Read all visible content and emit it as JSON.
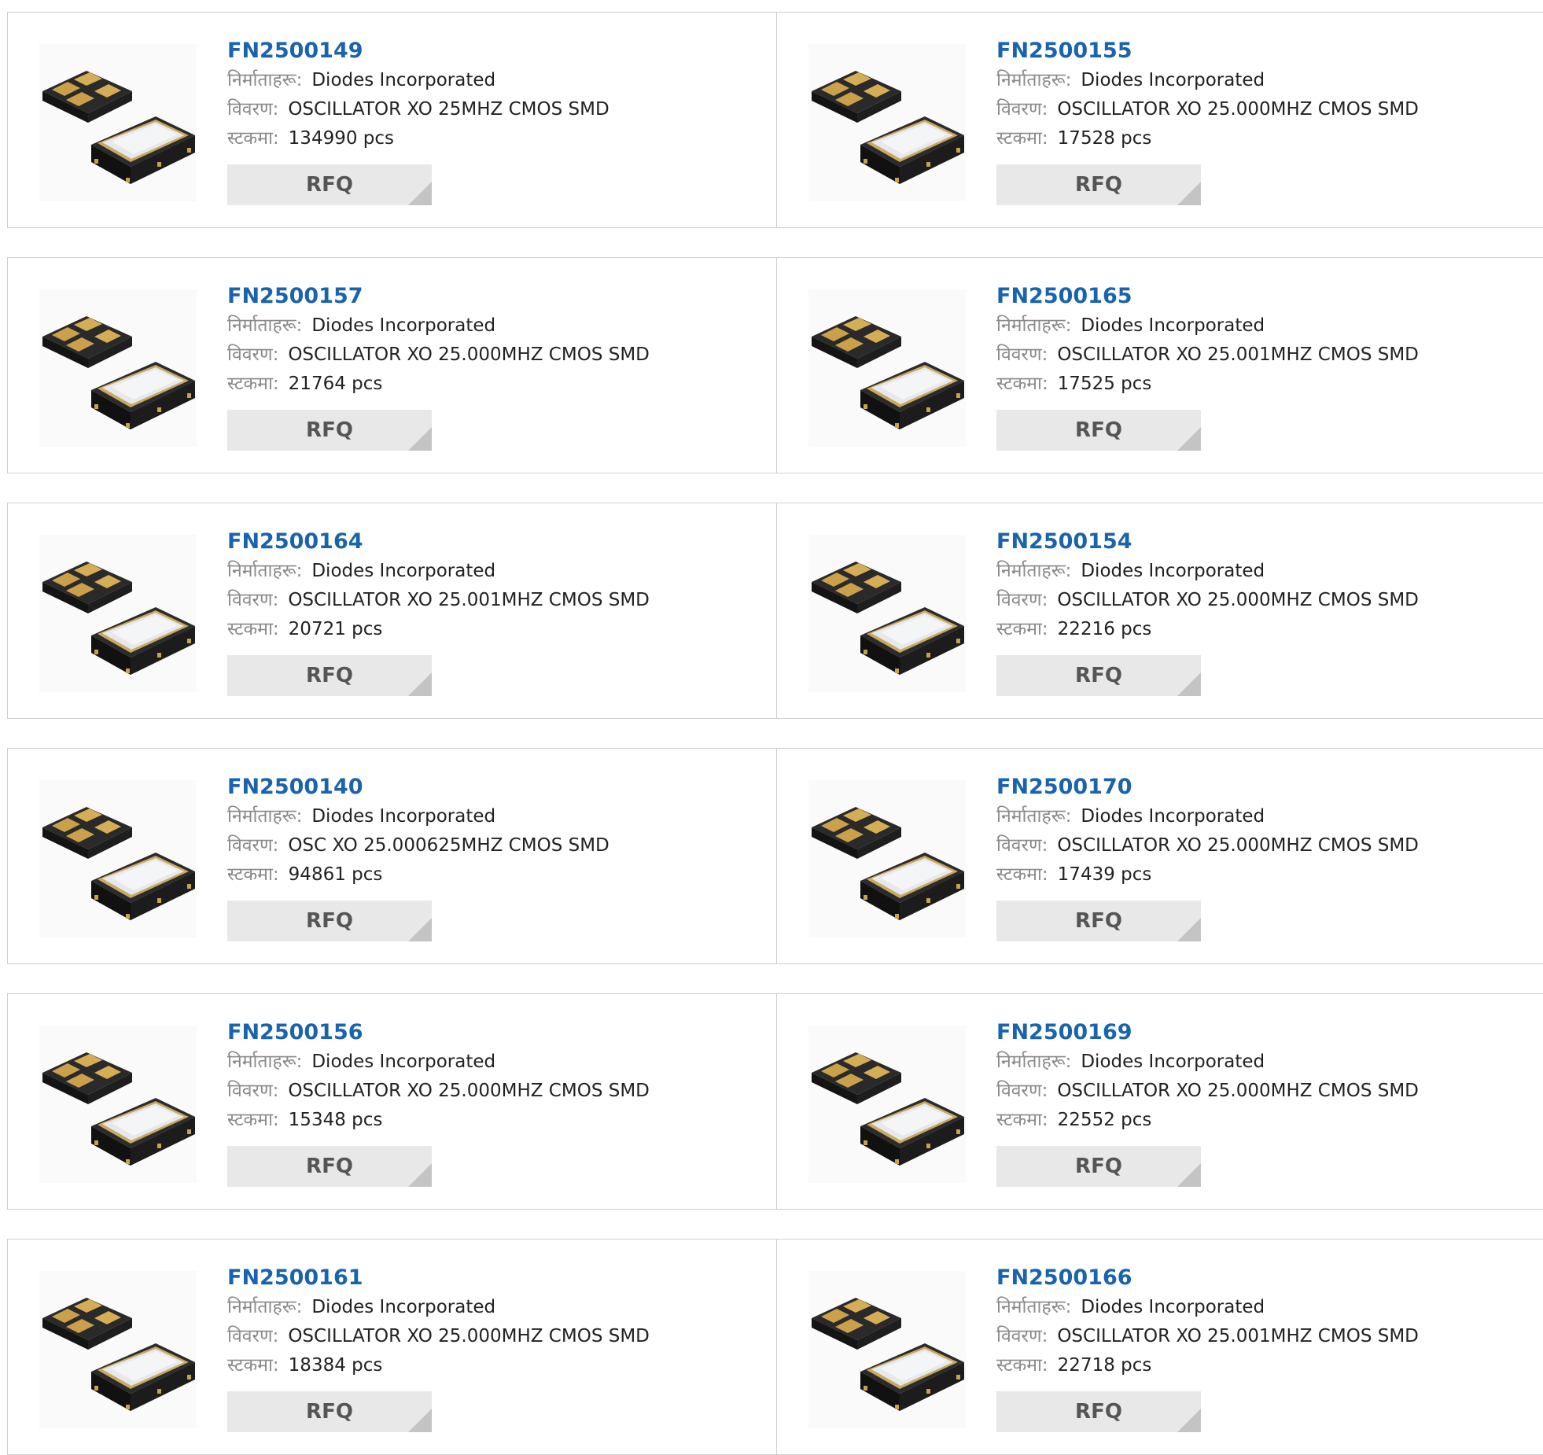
{
  "labels": {
    "manufacturer": "निर्माताहरू:",
    "description": "विवरण:",
    "stock": "स्टकमा:",
    "rfq": "RFQ"
  },
  "colors": {
    "link": "#1a64ad",
    "border": "#cfcfcf",
    "rfq_bg": "#e8e8e8",
    "rfq_corner": "#c4c4c4"
  },
  "products": [
    {
      "part": "FN2500149",
      "manufacturer": "Diodes Incorporated",
      "description": "OSCILLATOR XO 25MHZ CMOS SMD",
      "stock": "134990 pcs"
    },
    {
      "part": "FN2500155",
      "manufacturer": "Diodes Incorporated",
      "description": "OSCILLATOR XO 25.000MHZ CMOS SMD",
      "stock": "17528 pcs"
    },
    {
      "part": "FN2500157",
      "manufacturer": "Diodes Incorporated",
      "description": "OSCILLATOR XO 25.000MHZ CMOS SMD",
      "stock": "21764 pcs"
    },
    {
      "part": "FN2500165",
      "manufacturer": "Diodes Incorporated",
      "description": "OSCILLATOR XO 25.001MHZ CMOS SMD",
      "stock": "17525 pcs"
    },
    {
      "part": "FN2500164",
      "manufacturer": "Diodes Incorporated",
      "description": "OSCILLATOR XO 25.001MHZ CMOS SMD",
      "stock": "20721 pcs"
    },
    {
      "part": "FN2500154",
      "manufacturer": "Diodes Incorporated",
      "description": "OSCILLATOR XO 25.000MHZ CMOS SMD",
      "stock": "22216 pcs"
    },
    {
      "part": "FN2500140",
      "manufacturer": "Diodes Incorporated",
      "description": "OSC XO 25.000625MHZ CMOS SMD",
      "stock": "94861 pcs"
    },
    {
      "part": "FN2500170",
      "manufacturer": "Diodes Incorporated",
      "description": "OSCILLATOR XO 25.000MHZ CMOS SMD",
      "stock": "17439 pcs"
    },
    {
      "part": "FN2500156",
      "manufacturer": "Diodes Incorporated",
      "description": "OSCILLATOR XO 25.000MHZ CMOS SMD",
      "stock": "15348 pcs"
    },
    {
      "part": "FN2500169",
      "manufacturer": "Diodes Incorporated",
      "description": "OSCILLATOR XO 25.000MHZ CMOS SMD",
      "stock": "22552 pcs"
    },
    {
      "part": "FN2500161",
      "manufacturer": "Diodes Incorporated",
      "description": "OSCILLATOR XO 25.000MHZ CMOS SMD",
      "stock": "18384 pcs"
    },
    {
      "part": "FN2500166",
      "manufacturer": "Diodes Incorporated",
      "description": "OSCILLATOR XO 25.001MHZ CMOS SMD",
      "stock": "22718 pcs"
    }
  ]
}
